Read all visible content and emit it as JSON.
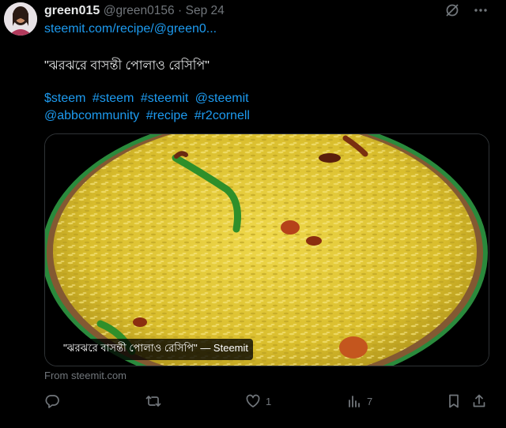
{
  "tweet": {
    "display_name": "green015",
    "handle": "@green0156",
    "separator": "·",
    "date": "Sep 24",
    "link_text": "steemit.com/recipe/@green0...",
    "title": "\"ঝরঝরে বাসন্তী পোলাও রেসিপি\"",
    "hashtags_line1": [
      "$steem",
      "#steem",
      "#steemit",
      "@steemit"
    ],
    "hashtags_line2": [
      "@abbcommunity",
      "#recipe",
      "#r2cornell"
    ],
    "card": {
      "caption": "\"ঝরঝরে বাসন্তী পোলাও রেসিপি\" — Steemit",
      "from_text": "From steemit.com"
    },
    "actions": {
      "reply_icon": "reply-icon",
      "retweet_icon": "retweet-icon",
      "like_count": "1",
      "views_count": "7"
    }
  },
  "colors": {
    "background": "#000000",
    "text": "#e7e9ea",
    "muted": "#71767b",
    "link": "#1d9bf0",
    "rice": "#e2c83a"
  }
}
